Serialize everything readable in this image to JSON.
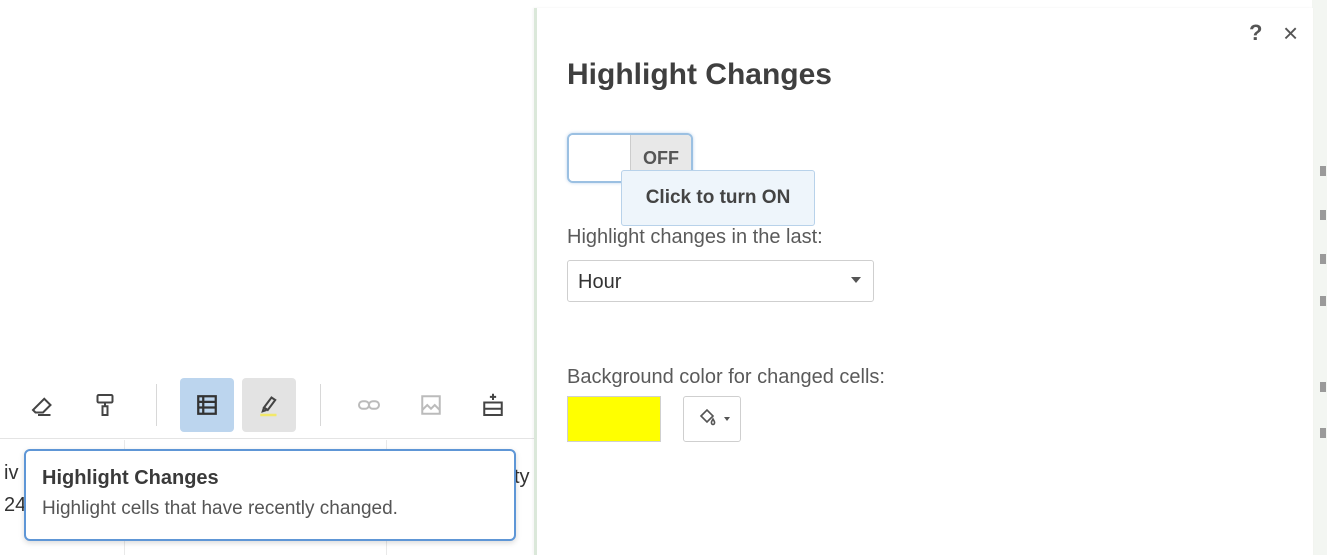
{
  "tooltip": {
    "title": "Highlight Changes",
    "description": "Highlight cells that have recently changed."
  },
  "sheet": {
    "fragments": [
      "iv",
      "24",
      "ty"
    ]
  },
  "toolbar": {
    "icons": [
      "eraser-icon",
      "paint-format-icon",
      "table-view-icon",
      "highlighter-icon",
      "link-icon",
      "image-icon",
      "insert-row-icon"
    ]
  },
  "dialog": {
    "title": "Highlight Changes",
    "help": "?",
    "close": "×",
    "toggle_state": "OFF",
    "toggle_tip": "Click to turn ON",
    "period_label": "Highlight changes in the last:",
    "period_value": "Hour",
    "color_label": "Background color for changed cells:",
    "color_value": "#ffff00"
  },
  "colors": {
    "accent": "#5e96d6",
    "active_tool": "#bcd5ee",
    "swatch": "#ffff00"
  }
}
